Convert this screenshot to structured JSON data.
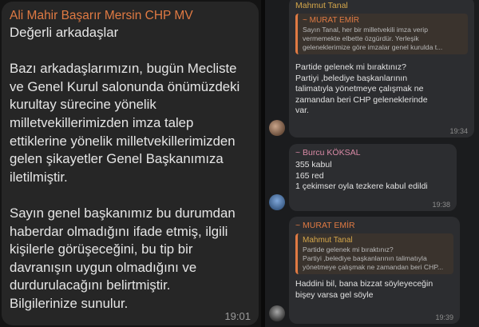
{
  "left_message": {
    "sender": "Ali Mahir Başarır Mersin CHP MV",
    "lines": [
      "Değerli arkadaşlar",
      "",
      "Bazı arkadaşlarımızın, bugün Mecliste",
      "ve Genel Kurul salonunda önümüzdeki",
      "kurultay sürecine yönelik",
      "milletvekillerimizden imza talep",
      "ettiklerine yönelik milletvekillerimizden",
      "gelen şikayetler Genel Başkanımıza",
      "iletilmiştir.",
      "",
      "Sayın genel başkanımız bu durumdan",
      "haberdar olmadığını ifade etmiş, ilgili",
      "kişilerle görüşeceğini, bu tip bir",
      "davranışın uygun olmadığını ve",
      "durdurulacağını belirtmiştir.",
      "Bilgilerinize sunulur."
    ],
    "time": "19:01"
  },
  "right_messages": [
    {
      "sender": "Mahmut Tanal",
      "quote": {
        "sender": "~ MURAT EMİR",
        "lines": [
          "Sayın Tanal, her bir milletvekili imza verip",
          "vermemekte elbette özgürdür. Yerleşik",
          "geleneklerimize göre imzalar genel kurulda t..."
        ]
      },
      "lines": [
        "Partide gelenek mi bıraktınız?",
        "Partiyi ,belediye başkanlarının",
        "talimatıyla yönetmeye çalışmak ne",
        "zamandan beri CHP geleneklerinde",
        "var."
      ],
      "time": "19:34"
    },
    {
      "sender": "~ Burcu KÖKSAL",
      "lines": [
        "355 kabul",
        "165 red",
        "1 çekimser oyla tezkere kabul edildi"
      ],
      "time": "19:38"
    },
    {
      "sender": "~ MURAT EMİR",
      "quote": {
        "sender": "Mahmut Tanal",
        "lines": [
          "Partide gelenek mi bıraktınız?",
          "Partiyi ,belediye başkanlarının talimatıyla",
          "yönetmeye çalışmak ne zamandan beri CHP..."
        ]
      },
      "lines": [
        "Haddini bil, bana bizzat söyleyeceğin",
        "bişey varsa gel söyle"
      ],
      "time": "19:39"
    }
  ],
  "colors": {
    "accent_orange": "#e07a43",
    "sender_pink": "#d98aa6",
    "sender_gold": "#d4a64a",
    "bubble": "#2c2d30"
  }
}
